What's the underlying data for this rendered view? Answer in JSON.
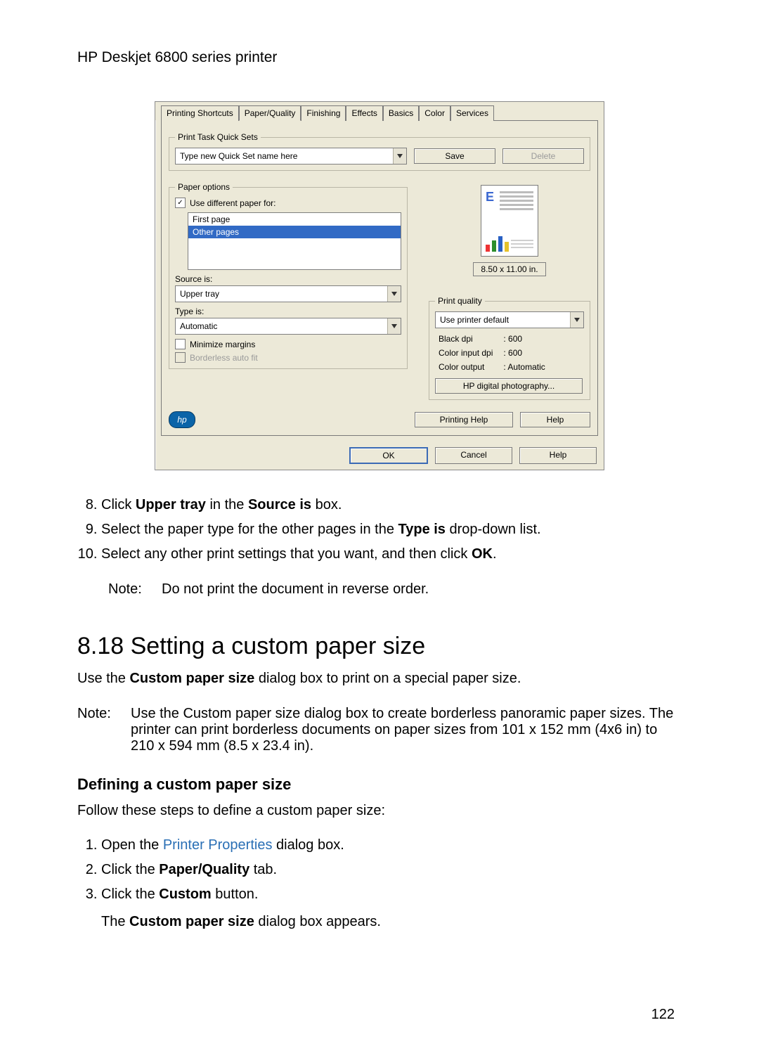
{
  "header": {
    "title": "HP Deskjet 6800 series printer"
  },
  "dialog": {
    "tabs": [
      "Printing Shortcuts",
      "Paper/Quality",
      "Finishing",
      "Effects",
      "Basics",
      "Color",
      "Services"
    ],
    "active_tab": "Paper/Quality",
    "quicksets": {
      "legend": "Print Task Quick Sets",
      "combo_value": "Type new Quick Set name here",
      "save": "Save",
      "delete": "Delete"
    },
    "paper_options": {
      "legend": "Paper options",
      "use_different_paper": "Use different paper for:",
      "list": {
        "item0": "First page",
        "item1": "Other pages"
      },
      "source_label": "Source is:",
      "source_value": "Upper tray",
      "type_label": "Type is:",
      "type_value": "Automatic",
      "minimize_margins": "Minimize margins",
      "borderless_auto_fit": "Borderless auto fit",
      "preview_letter": "E",
      "preview_size": "8.50 x 11.00 in."
    },
    "print_quality": {
      "legend": "Print quality",
      "combo_value": "Use printer default",
      "specs": {
        "black_dpi_label": "Black dpi",
        "black_dpi_value": ": 600",
        "color_input_dpi_label": "Color input dpi",
        "color_input_dpi_value": ": 600",
        "color_output_label": "Color output",
        "color_output_value": ": Automatic"
      },
      "hp_digital_photography": "HP digital photography..."
    },
    "logo_text": "hp",
    "printing_help": "Printing Help",
    "help_inner": "Help",
    "footer": {
      "ok": "OK",
      "cancel": "Cancel",
      "help": "Help"
    }
  },
  "doc": {
    "steps_8_10": {
      "s8_a": "Click ",
      "s8_b": "Upper tray",
      "s8_c": " in the ",
      "s8_d": "Source is",
      "s8_e": " box.",
      "s9_a": "Select the paper type for the other pages in the ",
      "s9_b": "Type is",
      "s9_c": " drop-down list.",
      "s10_a": "Select any other print settings that you want, and then click ",
      "s10_b": "OK",
      "s10_c": "."
    },
    "note1": {
      "label": "Note:",
      "text": "Do not print the document in reverse order."
    },
    "h2": "8.18  Setting a custom paper size",
    "intro_a": "Use the ",
    "intro_b": "Custom paper size",
    "intro_c": " dialog box to print on a special paper size.",
    "note2": {
      "label": "Note:",
      "text": "Use the Custom paper size dialog box to create borderless panoramic paper sizes. The printer can print borderless documents on paper sizes from 101 x 152 mm (4x6 in) to 210 x 594 mm (8.5 x 23.4 in)."
    },
    "sub_h": "Defining a custom paper size",
    "sub_intro": "Follow these steps to define a custom paper size:",
    "steps_1_3": {
      "s1_a": "Open the ",
      "s1_b": "Printer Properties",
      "s1_c": " dialog box.",
      "s2_a": "Click the ",
      "s2_b": "Paper/Quality",
      "s2_c": " tab.",
      "s3_a": "Click the ",
      "s3_b": "Custom",
      "s3_c": " button.",
      "s3_follow_a": "The ",
      "s3_follow_b": "Custom paper size",
      "s3_follow_c": " dialog box appears."
    }
  },
  "page_number": "122"
}
